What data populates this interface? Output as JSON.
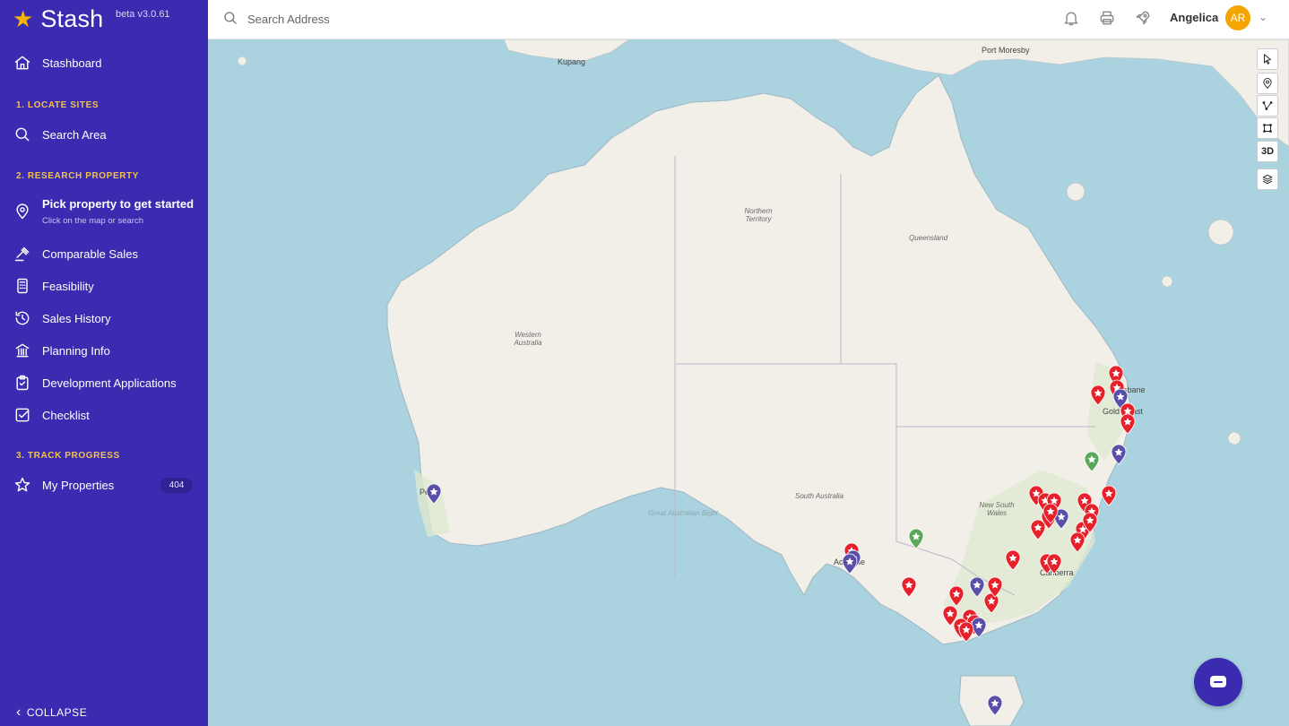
{
  "app": {
    "name": "Stash",
    "version": "beta v3.0.61"
  },
  "sidebar": {
    "stashboard": "Stashboard",
    "section1": "1. LOCATE SITES",
    "search_area": "Search Area",
    "section2": "2. RESEARCH PROPERTY",
    "pick_property": "Pick property to get started",
    "pick_property_sub": "Click on the map or search",
    "comparable_sales": "Comparable Sales",
    "feasibility": "Feasibility",
    "sales_history": "Sales History",
    "planning_info": "Planning Info",
    "development_applications": "Development Applications",
    "checklist": "Checklist",
    "section3": "3. TRACK PROGRESS",
    "my_properties": "My Properties",
    "my_properties_count": "404",
    "collapse": "COLLAPSE"
  },
  "header": {
    "search_placeholder": "Search Address",
    "user_name": "Angelica",
    "user_initials": "AR"
  },
  "map": {
    "labels": {
      "kupang": "Kupang",
      "port_moresby": "Port Moresby",
      "northern_territory": "Northern Territory",
      "queensland": "Queensland",
      "western_australia": "Western Australia",
      "south_australia": "South Australia",
      "new_south_wales": "New South Wales",
      "great_australian_bight": "Great Australian Bight",
      "brisbane": "Brisbane",
      "gold_coast": "Gold Coast",
      "adelaide": "Adelaide",
      "canberra": "Canberra",
      "perth": "Perth"
    },
    "control_3d": "3D",
    "colors": {
      "sidebar": "#3a2bb0",
      "ocean": "#aad3df",
      "land": "#f2efe9",
      "pin_red": "#e8202a",
      "pin_purple": "#5a4fa8",
      "pin_green": "#5aa85a"
    }
  }
}
